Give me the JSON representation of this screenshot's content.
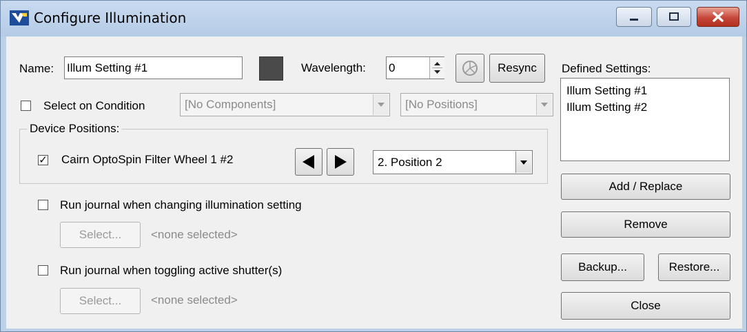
{
  "window": {
    "title": "Configure Illumination"
  },
  "name_field": {
    "label": "Name:",
    "value": "Illum Setting #1"
  },
  "wavelength": {
    "label": "Wavelength:",
    "value": "0"
  },
  "resync_label": "Resync",
  "select_on_condition": {
    "label": "Select on Condition",
    "checked": false,
    "components_value": "[No Components]",
    "positions_value": "[No Positions]"
  },
  "device_positions": {
    "group_label": "Device Positions:",
    "device_label": "Cairn OptoSpin Filter Wheel 1 #2",
    "checked": true,
    "position_value": "2. Position 2"
  },
  "journal_change": {
    "label": "Run journal when changing illumination setting",
    "select_label": "Select...",
    "selection": "<none selected>"
  },
  "journal_shutter": {
    "label": "Run journal when toggling active shutter(s)",
    "select_label": "Select...",
    "selection": "<none selected>"
  },
  "defined_settings": {
    "label": "Defined Settings:",
    "items": [
      "Illum Setting #1",
      "Illum Setting #2"
    ]
  },
  "buttons": {
    "add_replace": "Add / Replace",
    "remove": "Remove",
    "backup": "Backup...",
    "restore": "Restore...",
    "close": "Close"
  },
  "colors": {
    "swatch": "#4a4a4a",
    "titlebar": "#bcd0e8",
    "close_button": "#c6473a"
  }
}
